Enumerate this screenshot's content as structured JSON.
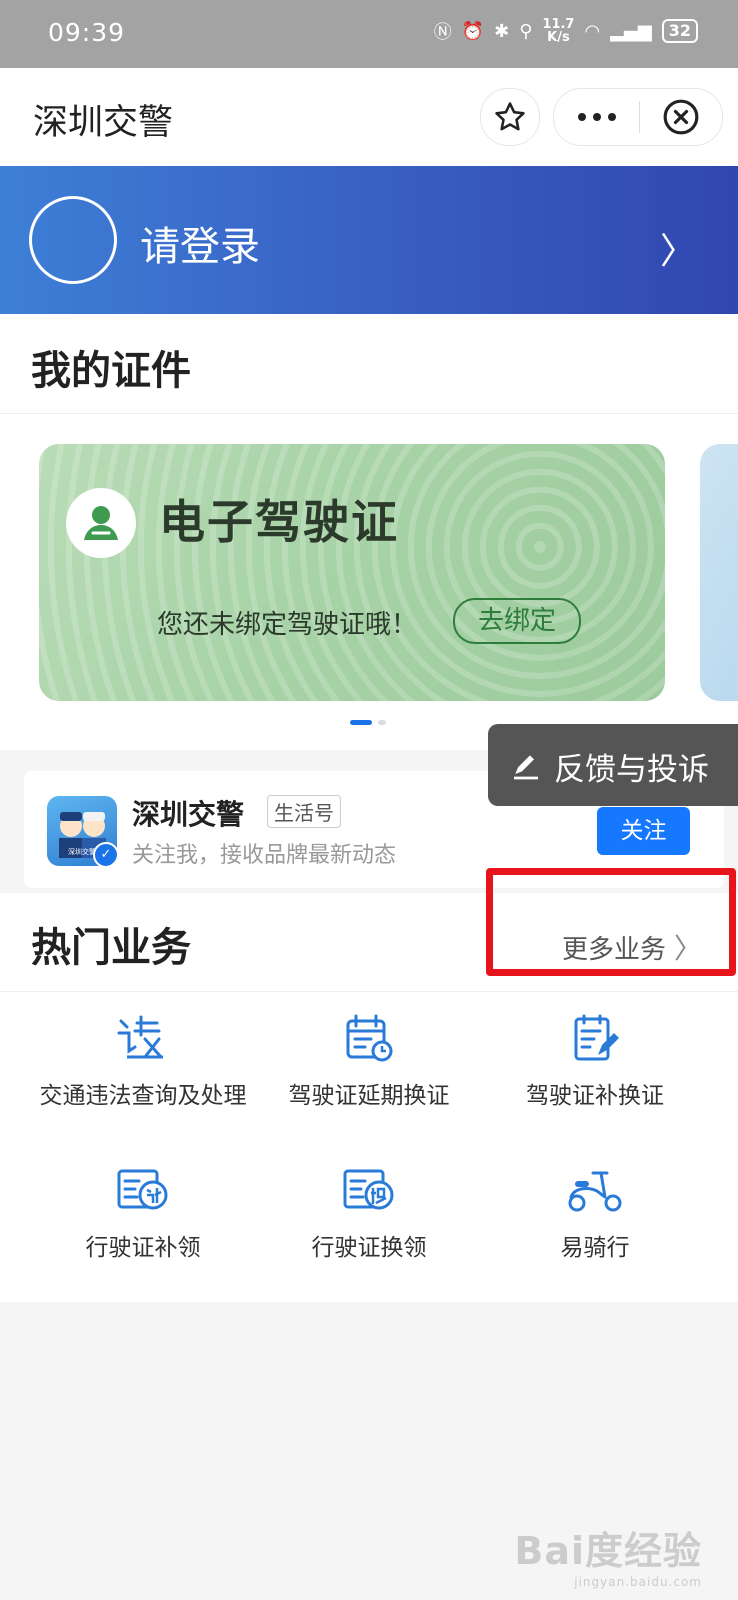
{
  "status_bar": {
    "time": "09:39",
    "speed_value": "11.7",
    "speed_unit": "K/s",
    "battery": "32"
  },
  "title_bar": {
    "title": "深圳交警"
  },
  "banner": {
    "login_text": "请登录"
  },
  "my_certificates": {
    "heading": "我的证件",
    "card": {
      "title": "电子驾驶证",
      "message": "您还未绑定驾驶证哦！",
      "bind_label": "去绑定"
    }
  },
  "life_account": {
    "name": "深圳交警",
    "tag": "生活号",
    "description": "关注我，接收品牌最新动态",
    "follow_label": "关注",
    "logo_text": "深圳交警"
  },
  "feedback": {
    "label": "反馈与投诉"
  },
  "hot_services": {
    "heading": "热门业务",
    "more_label": "更多业务",
    "items": [
      {
        "label": "交通违法查询及处理",
        "icon": "violation-icon"
      },
      {
        "label": "驾驶证延期换证",
        "icon": "calendar-clock-icon"
      },
      {
        "label": "驾驶证补换证",
        "icon": "document-edit-icon"
      },
      {
        "label": "行驶证补领",
        "icon": "card-reissue-icon"
      },
      {
        "label": "行驶证换领",
        "icon": "card-exchange-icon"
      },
      {
        "label": "易骑行",
        "icon": "scooter-icon"
      }
    ]
  },
  "watermark": {
    "text": "Bai度经验",
    "url_text": "jingyan.baidu.com"
  },
  "colors": {
    "accent": "#1677ff",
    "banner_start": "#3d7fd6",
    "banner_end": "#3147b0",
    "highlight": "#e8141b",
    "card_green": "#a9d3a8"
  }
}
